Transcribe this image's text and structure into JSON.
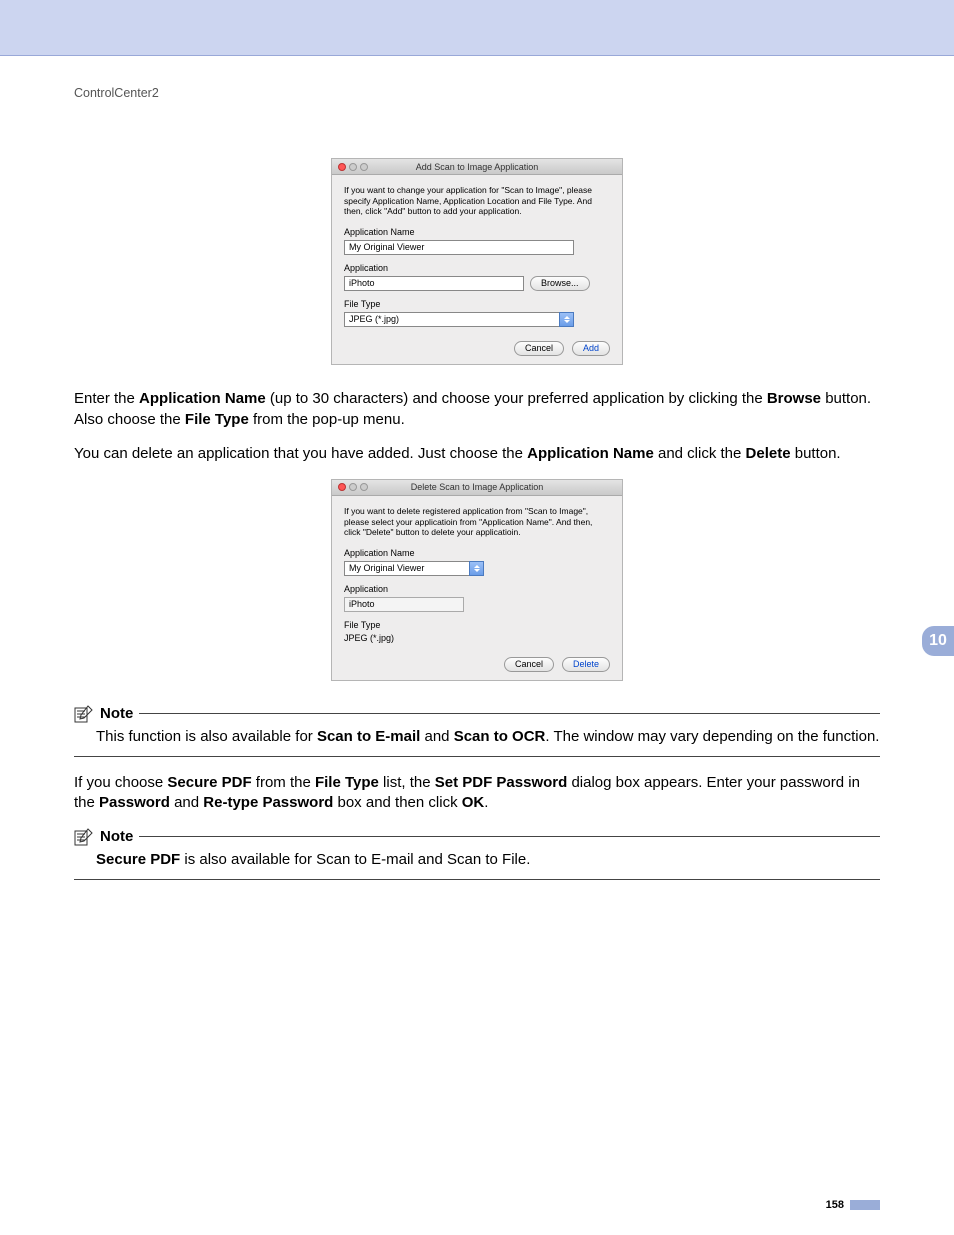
{
  "breadcrumb": "ControlCenter2",
  "dialog_add": {
    "title": "Add Scan to Image Application",
    "desc": "If you want to change your application for \"Scan to Image\", please specify Application Name, Application Location and File Type.\nAnd then, click \"Add\" button to add your application.",
    "appname_label": "Application Name",
    "appname_value": "My Original Viewer",
    "application_label": "Application",
    "application_value": "iPhoto",
    "browse_label": "Browse...",
    "filetype_label": "File Type",
    "filetype_value": "JPEG (*.jpg)",
    "cancel_label": "Cancel",
    "add_label": "Add"
  },
  "para1_parts": {
    "t1": "Enter the ",
    "b1": "Application Name",
    "t2": " (up to 30 characters) and choose your preferred application by clicking the ",
    "b2": "Browse",
    "t3": " button. Also choose the ",
    "b3": "File Type",
    "t4": " from the pop-up menu."
  },
  "para2_parts": {
    "t1": "You can delete an application that you have added. Just choose the ",
    "b1": "Application Name",
    "t2": " and click the ",
    "b2": "Delete",
    "t3": " button."
  },
  "dialog_del": {
    "title": "Delete Scan to Image Application",
    "desc": "If you want to delete registered application from \"Scan to Image\", please select your applicatioin from \"Application Name\".\nAnd then, click \"Delete\" button to delete your applicatioin.",
    "appname_label": "Application Name",
    "appname_value": "My Original Viewer",
    "application_label": "Application",
    "application_value": "iPhoto",
    "filetype_label": "File Type",
    "filetype_value": "JPEG (*.jpg)",
    "cancel_label": "Cancel",
    "delete_label": "Delete"
  },
  "note_label": "Note",
  "note1_parts": {
    "t1": "This function is also available for ",
    "b1": "Scan to E-mail",
    "t2": " and ",
    "b2": "Scan to OCR",
    "t3": ". The window may vary depending on the function."
  },
  "para3_parts": {
    "t1": "If you choose ",
    "b1": "Secure PDF",
    "t2": " from the ",
    "b2": "File Type",
    "t3": " list, the ",
    "b3": "Set PDF Password",
    "t4": " dialog box appears. Enter your password in the ",
    "b4": "Password",
    "t5": " and ",
    "b5": "Re-type Password",
    "t6": " box and then click ",
    "b6": "OK",
    "t7": "."
  },
  "note2_parts": {
    "b1": "Secure PDF",
    "t1": " is also available for Scan to E-mail and Scan to File."
  },
  "chapter_tab": "10",
  "page_number": "158"
}
